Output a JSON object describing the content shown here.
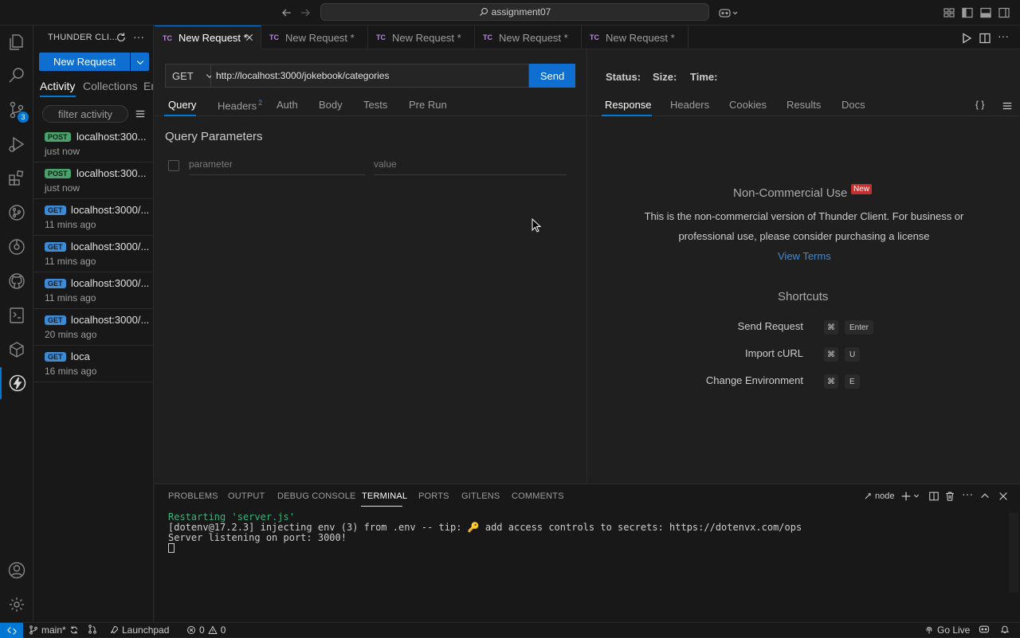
{
  "titlebar": {
    "search_text": "assignment07"
  },
  "sidebar": {
    "title": "THUNDER CLI...",
    "new_request_label": "New Request",
    "tabs": [
      {
        "label": "Activity"
      },
      {
        "label": "Collections"
      },
      {
        "label": "En"
      }
    ],
    "filter_placeholder": "filter activity",
    "history": [
      {
        "method": "POST",
        "url": "localhost:300...",
        "time": "just now"
      },
      {
        "method": "POST",
        "url": "localhost:300...",
        "time": "just now"
      },
      {
        "method": "GET",
        "url": "localhost:3000/...",
        "time": "11 mins ago"
      },
      {
        "method": "GET",
        "url": "localhost:3000/...",
        "time": "11 mins ago"
      },
      {
        "method": "GET",
        "url": "localhost:3000/...",
        "time": "11 mins ago"
      },
      {
        "method": "GET",
        "url": "localhost:3000/...",
        "time": "20 mins ago"
      },
      {
        "method": "GET",
        "url": "loca",
        "time": "16 mins ago"
      }
    ]
  },
  "activitybar": {
    "source_control_badge": "3"
  },
  "editor_tabs": [
    {
      "prefix": "TC",
      "label": "New Request *"
    },
    {
      "prefix": "TC",
      "label": "New Request *"
    },
    {
      "prefix": "TC",
      "label": "New Request *"
    },
    {
      "prefix": "TC",
      "label": "New Request *"
    },
    {
      "prefix": "TC",
      "label": "New Request *"
    }
  ],
  "request": {
    "method": "GET",
    "url": "http://localhost:3000/jokebook/categories",
    "send_label": "Send",
    "tabs": [
      {
        "label": "Query"
      },
      {
        "label": "Headers",
        "count": "2"
      },
      {
        "label": "Auth"
      },
      {
        "label": "Body"
      },
      {
        "label": "Tests"
      },
      {
        "label": "Pre Run"
      }
    ],
    "query_title": "Query Parameters",
    "param_placeholder": "parameter",
    "value_placeholder": "value"
  },
  "response": {
    "status_label": "Status:",
    "size_label": "Size:",
    "time_label": "Time:",
    "tabs": [
      {
        "label": "Response"
      },
      {
        "label": "Headers"
      },
      {
        "label": "Cookies"
      },
      {
        "label": "Results"
      },
      {
        "label": "Docs"
      }
    ],
    "braces": "{ }",
    "notice_title": "Non-Commercial Use",
    "notice_badge": "New",
    "notice_line1": "This is the non-commercial version of Thunder Client. For business or",
    "notice_line2": "professional use, please consider purchasing a license",
    "view_terms": "View Terms",
    "shortcuts_title": "Shortcuts",
    "shortcuts": [
      {
        "label": "Send Request",
        "key1": "⌘",
        "key2": "Enter"
      },
      {
        "label": "Import cURL",
        "key1": "⌘",
        "key2": "U"
      },
      {
        "label": "Change Environment",
        "key1": "⌘",
        "key2": "E"
      }
    ]
  },
  "panel": {
    "tabs": [
      {
        "label": "PROBLEMS"
      },
      {
        "label": "OUTPUT"
      },
      {
        "label": "DEBUG CONSOLE"
      },
      {
        "label": "TERMINAL"
      },
      {
        "label": "PORTS"
      },
      {
        "label": "GITLENS"
      },
      {
        "label": "COMMENTS"
      }
    ],
    "terminal_name": "node",
    "terminal_lines": [
      "Restarting 'server.js'",
      "[dotenv@17.2.3] injecting env (3) from .env -- tip: 🔑 add access controls to secrets: https://dotenvx.com/ops",
      "Server listening on port: 3000!"
    ]
  },
  "statusbar": {
    "branch": "main*",
    "launchpad": "Launchpad",
    "errors": "0",
    "warnings": "0",
    "go_live": "Go Live"
  },
  "colors": {
    "accent": "#0078d4",
    "post": "#49a26b",
    "get": "#3d8bd6",
    "new_badge": "#c72e2e"
  }
}
